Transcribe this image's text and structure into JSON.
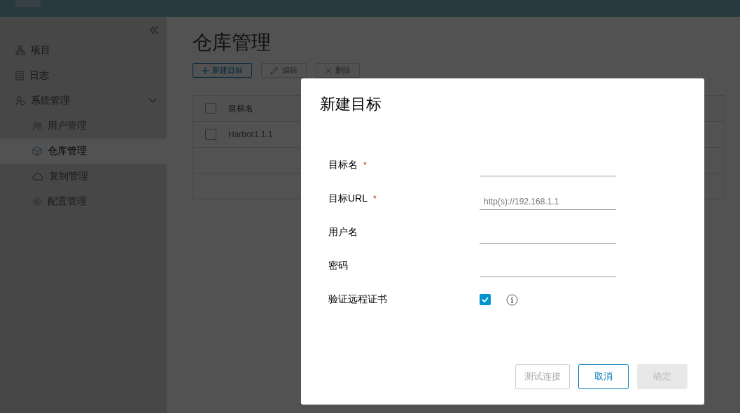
{
  "sidebar": {
    "items": [
      {
        "label": "项目",
        "selected": false
      },
      {
        "label": "日志",
        "selected": false
      },
      {
        "label": "系统管理",
        "selected": false,
        "expanded": true,
        "children": [
          {
            "label": "用户管理",
            "selected": false
          },
          {
            "label": "仓库管理",
            "selected": true
          },
          {
            "label": "复制管理",
            "selected": false
          },
          {
            "label": "配置管理",
            "selected": false
          }
        ]
      }
    ]
  },
  "page": {
    "title": "仓库管理",
    "toolbar": [
      {
        "label": "新建目标",
        "kind": "add",
        "disabled": false
      },
      {
        "label": "编辑",
        "kind": "edit",
        "disabled": true
      },
      {
        "label": "删除",
        "kind": "delete",
        "disabled": true
      }
    ],
    "table": {
      "all_selected": false,
      "columns": [
        "目标名"
      ],
      "rows": [
        {
          "cells": [
            "Harbor1.1.1"
          ],
          "selected": false
        }
      ]
    }
  },
  "dialog": {
    "title": "新建目标",
    "fields": [
      {
        "kind": "text",
        "label": "目标名",
        "required_mark": "*"
      },
      {
        "kind": "text",
        "label": "目标URL",
        "required_mark": "*",
        "placeholder": "http(s)://192.168.1.1"
      },
      {
        "kind": "text",
        "label": "用户名"
      },
      {
        "kind": "password",
        "label": "密码"
      },
      {
        "kind": "checkbox",
        "label": "验证远程证书",
        "checked": true
      }
    ],
    "buttons": [
      {
        "label": "测试连接",
        "kind": "secondary",
        "disabled": true
      },
      {
        "label": "取消",
        "kind": "secondary",
        "disabled": false
      },
      {
        "label": "确定",
        "kind": "primary",
        "disabled": true
      }
    ]
  }
}
